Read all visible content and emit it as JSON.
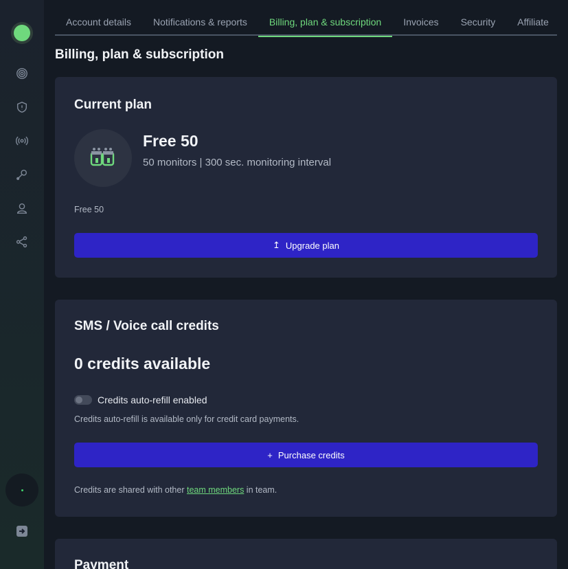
{
  "tabs": [
    "Account details",
    "Notifications & reports",
    "Billing, plan & subscription",
    "Invoices",
    "Security",
    "Affiliate"
  ],
  "active_tab": "Billing, plan & subscription",
  "page_title": "Billing, plan & subscription",
  "sidebar": {
    "icons": [
      "monitors-icon",
      "incidents-shield-icon",
      "status-broadcast-icon",
      "maintenance-wrench-icon",
      "team-user-icon",
      "integrations-share-icon"
    ],
    "status_color": "#3fd36b"
  },
  "current_plan": {
    "title": "Current plan",
    "plan_name": "Free 50",
    "plan_description": "50 monitors | 300 sec. monitoring interval",
    "plan_label": "Free 50",
    "upgrade_button": "Upgrade plan",
    "upgrade_icon": "↥"
  },
  "sms_credits": {
    "title": "SMS / Voice call credits",
    "credits_available": "0 credits available",
    "auto_refill_label": "Credits auto-refill enabled",
    "auto_refill_enabled": false,
    "auto_refill_note": "Credits auto-refill is available only for credit card payments.",
    "purchase_button": "Purchase credits",
    "purchase_icon": "+",
    "shared_prefix": "Credits are shared with other ",
    "shared_link": "team members",
    "shared_suffix": " in team."
  },
  "payment": {
    "title": "Payment"
  },
  "colors": {
    "accent_green": "#6fd97d",
    "button_blue": "#2e24c6",
    "card_bg": "#222839",
    "page_bg": "#141a23"
  }
}
